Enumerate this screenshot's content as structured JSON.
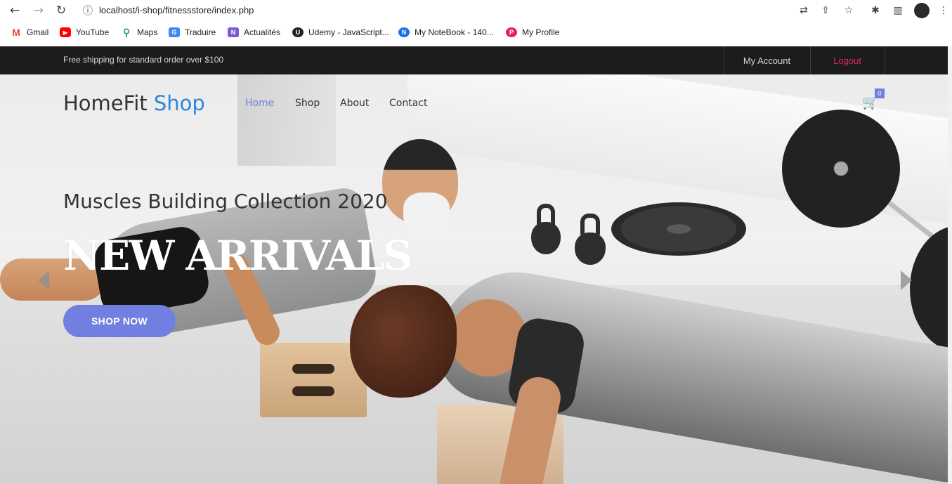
{
  "browser": {
    "url": "localhost/i-shop/fitnessstore/index.php",
    "bookmarks": [
      {
        "label": "Gmail",
        "icon": "M"
      },
      {
        "label": "YouTube",
        "icon": "▶"
      },
      {
        "label": "Maps",
        "icon": "⚲"
      },
      {
        "label": "Traduire",
        "icon": "G"
      },
      {
        "label": "Actualités",
        "icon": "N"
      },
      {
        "label": "Udemy - JavaScript...",
        "icon": "U"
      },
      {
        "label": "My NoteBook - 140...",
        "icon": "N"
      },
      {
        "label": "My Profile",
        "icon": "P"
      }
    ]
  },
  "topbar": {
    "shipping_text": "Free shipping for standard order over $100",
    "account_label": "My Account",
    "logout_label": "Logout"
  },
  "header": {
    "logo_main": "HomeFit ",
    "logo_accent": "Shop",
    "menu": [
      "Home",
      "Shop",
      "About",
      "Contact"
    ],
    "cart_count": "0"
  },
  "hero": {
    "subtitle": "Muscles Building Collection 2020",
    "title": "NEW ARRIVALS",
    "button_label": "SHOP NOW"
  },
  "colors": {
    "accent": "#717fe0",
    "topbar_bg": "#1c1c1c",
    "logout": "#e0245e",
    "logo_accent": "#2e86de"
  }
}
